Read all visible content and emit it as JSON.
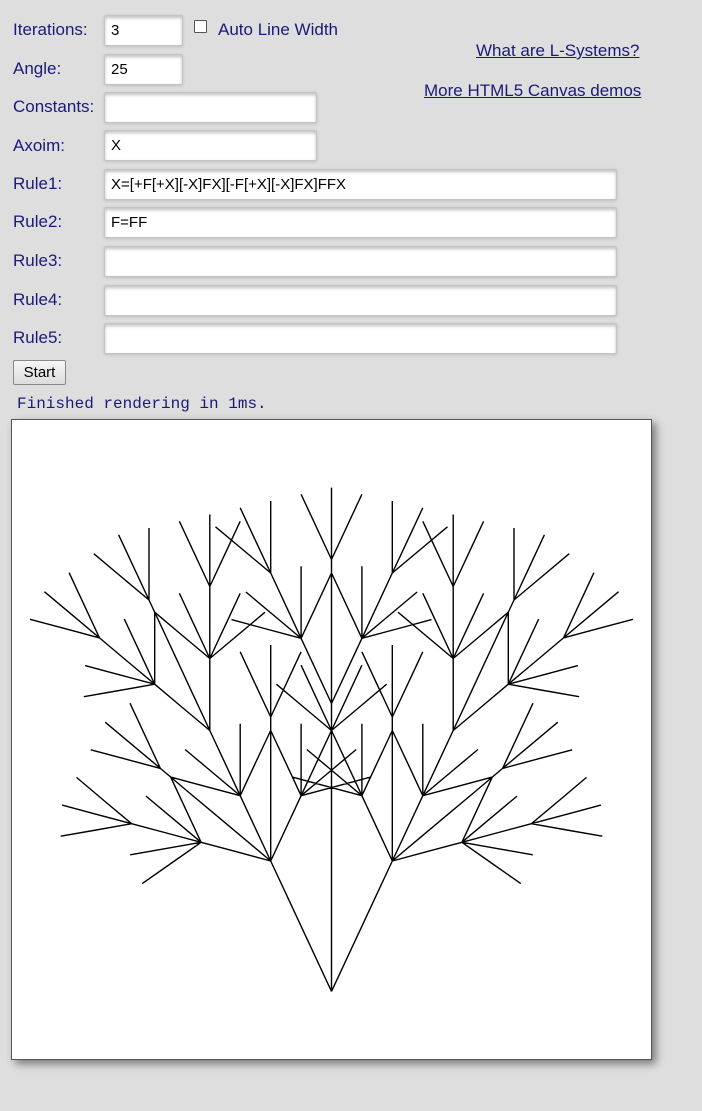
{
  "form": {
    "iterations": {
      "label": "Iterations:",
      "value": "3"
    },
    "angle": {
      "label": "Angle:",
      "value": "25"
    },
    "constants": {
      "label": "Constants:",
      "value": ""
    },
    "axiom": {
      "label": "Axoim:",
      "value": "X"
    },
    "rule1": {
      "label": "Rule1:",
      "value": "X=[+F[+X][-X]FX][-F[+X][-X]FX]FFX"
    },
    "rule2": {
      "label": "Rule2:",
      "value": "F=FF"
    },
    "rule3": {
      "label": "Rule3:",
      "value": ""
    },
    "rule4": {
      "label": "Rule4:",
      "value": ""
    },
    "rule5": {
      "label": "Rule5:",
      "value": ""
    },
    "auto_line_width": {
      "label": "Auto Line Width",
      "checked": false
    }
  },
  "links": {
    "what_are": "What are L-Systems?",
    "more_demos": "More HTML5 Canvas demos"
  },
  "start_label": "Start",
  "status_text": "Finished rendering in 1ms.",
  "canvas": {
    "background": "#ffffff",
    "stroke": "#000000"
  },
  "colors": {
    "page_background": "#dedede",
    "text": "#1a1a7a"
  }
}
